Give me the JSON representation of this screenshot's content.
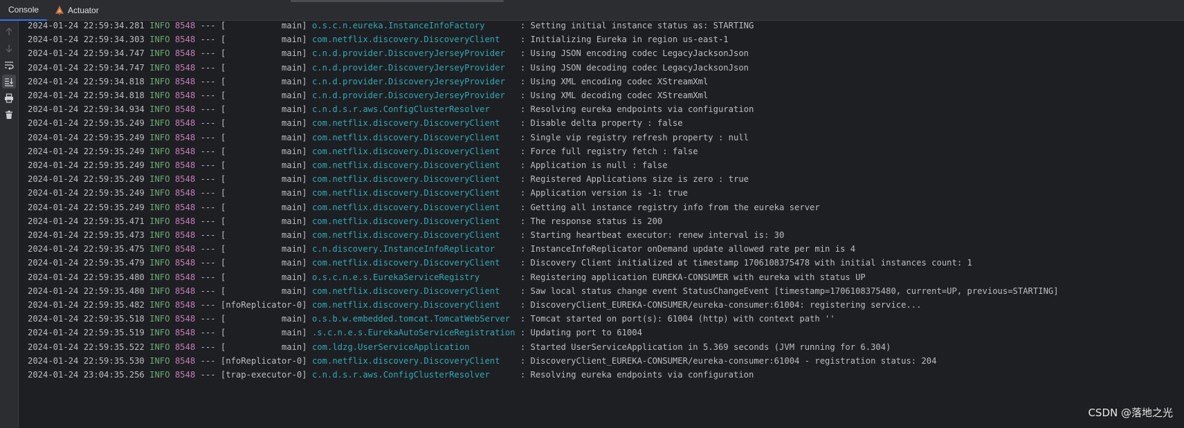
{
  "tabs": [
    {
      "label": "Console",
      "active": true,
      "icon": null
    },
    {
      "label": "Actuator",
      "active": false,
      "icon": "actuator-icon"
    }
  ],
  "gutter": {
    "buttons": [
      {
        "icon": "up-arrow-icon",
        "active": false
      },
      {
        "icon": "down-arrow-icon",
        "active": false
      },
      {
        "icon": "soft-wrap-icon",
        "active": false
      },
      {
        "icon": "scroll-to-end-icon",
        "active": true
      },
      {
        "icon": "print-icon",
        "active": false
      },
      {
        "icon": "trash-icon",
        "active": false
      }
    ]
  },
  "colors": {
    "background": "#1e1f22",
    "panel": "#2b2d30",
    "level": "#6aab73",
    "pid": "#c77dbb",
    "logger": "#2aacb8",
    "text": "#bcbec4",
    "active_tab": "#3574f0"
  },
  "log": [
    {
      "ts": "2024-01-24 22:59:34.281",
      "level": "INFO",
      "pid": "8548",
      "sep": "---",
      "thread": "[           main]",
      "logger": "o.s.c.n.eureka.InstanceInfoFactory      ",
      "msg": ": Setting initial instance status as: STARTING"
    },
    {
      "ts": "2024-01-24 22:59:34.303",
      "level": "INFO",
      "pid": "8548",
      "sep": "---",
      "thread": "[           main]",
      "logger": "com.netflix.discovery.DiscoveryClient   ",
      "msg": ": Initializing Eureka in region us-east-1"
    },
    {
      "ts": "2024-01-24 22:59:34.747",
      "level": "INFO",
      "pid": "8548",
      "sep": "---",
      "thread": "[           main]",
      "logger": "c.n.d.provider.DiscoveryJerseyProvider  ",
      "msg": ": Using JSON encoding codec LegacyJacksonJson"
    },
    {
      "ts": "2024-01-24 22:59:34.747",
      "level": "INFO",
      "pid": "8548",
      "sep": "---",
      "thread": "[           main]",
      "logger": "c.n.d.provider.DiscoveryJerseyProvider  ",
      "msg": ": Using JSON decoding codec LegacyJacksonJson"
    },
    {
      "ts": "2024-01-24 22:59:34.818",
      "level": "INFO",
      "pid": "8548",
      "sep": "---",
      "thread": "[           main]",
      "logger": "c.n.d.provider.DiscoveryJerseyProvider  ",
      "msg": ": Using XML encoding codec XStreamXml"
    },
    {
      "ts": "2024-01-24 22:59:34.818",
      "level": "INFO",
      "pid": "8548",
      "sep": "---",
      "thread": "[           main]",
      "logger": "c.n.d.provider.DiscoveryJerseyProvider  ",
      "msg": ": Using XML decoding codec XStreamXml"
    },
    {
      "ts": "2024-01-24 22:59:34.934",
      "level": "INFO",
      "pid": "8548",
      "sep": "---",
      "thread": "[           main]",
      "logger": "c.n.d.s.r.aws.ConfigClusterResolver     ",
      "msg": ": Resolving eureka endpoints via configuration"
    },
    {
      "ts": "2024-01-24 22:59:35.249",
      "level": "INFO",
      "pid": "8548",
      "sep": "---",
      "thread": "[           main]",
      "logger": "com.netflix.discovery.DiscoveryClient   ",
      "msg": ": Disable delta property : false"
    },
    {
      "ts": "2024-01-24 22:59:35.249",
      "level": "INFO",
      "pid": "8548",
      "sep": "---",
      "thread": "[           main]",
      "logger": "com.netflix.discovery.DiscoveryClient   ",
      "msg": ": Single vip registry refresh property : null"
    },
    {
      "ts": "2024-01-24 22:59:35.249",
      "level": "INFO",
      "pid": "8548",
      "sep": "---",
      "thread": "[           main]",
      "logger": "com.netflix.discovery.DiscoveryClient   ",
      "msg": ": Force full registry fetch : false"
    },
    {
      "ts": "2024-01-24 22:59:35.249",
      "level": "INFO",
      "pid": "8548",
      "sep": "---",
      "thread": "[           main]",
      "logger": "com.netflix.discovery.DiscoveryClient   ",
      "msg": ": Application is null : false"
    },
    {
      "ts": "2024-01-24 22:59:35.249",
      "level": "INFO",
      "pid": "8548",
      "sep": "---",
      "thread": "[           main]",
      "logger": "com.netflix.discovery.DiscoveryClient   ",
      "msg": ": Registered Applications size is zero : true"
    },
    {
      "ts": "2024-01-24 22:59:35.249",
      "level": "INFO",
      "pid": "8548",
      "sep": "---",
      "thread": "[           main]",
      "logger": "com.netflix.discovery.DiscoveryClient   ",
      "msg": ": Application version is -1: true"
    },
    {
      "ts": "2024-01-24 22:59:35.249",
      "level": "INFO",
      "pid": "8548",
      "sep": "---",
      "thread": "[           main]",
      "logger": "com.netflix.discovery.DiscoveryClient   ",
      "msg": ": Getting all instance registry info from the eureka server"
    },
    {
      "ts": "2024-01-24 22:59:35.471",
      "level": "INFO",
      "pid": "8548",
      "sep": "---",
      "thread": "[           main]",
      "logger": "com.netflix.discovery.DiscoveryClient   ",
      "msg": ": The response status is 200"
    },
    {
      "ts": "2024-01-24 22:59:35.473",
      "level": "INFO",
      "pid": "8548",
      "sep": "---",
      "thread": "[           main]",
      "logger": "com.netflix.discovery.DiscoveryClient   ",
      "msg": ": Starting heartbeat executor: renew interval is: 30"
    },
    {
      "ts": "2024-01-24 22:59:35.475",
      "level": "INFO",
      "pid": "8548",
      "sep": "---",
      "thread": "[           main]",
      "logger": "c.n.discovery.InstanceInfoReplicator    ",
      "msg": ": InstanceInfoReplicator onDemand update allowed rate per min is 4"
    },
    {
      "ts": "2024-01-24 22:59:35.479",
      "level": "INFO",
      "pid": "8548",
      "sep": "---",
      "thread": "[           main]",
      "logger": "com.netflix.discovery.DiscoveryClient   ",
      "msg": ": Discovery Client initialized at timestamp 1706108375478 with initial instances count: 1"
    },
    {
      "ts": "2024-01-24 22:59:35.480",
      "level": "INFO",
      "pid": "8548",
      "sep": "---",
      "thread": "[           main]",
      "logger": "o.s.c.n.e.s.EurekaServiceRegistry       ",
      "msg": ": Registering application EUREKA-CONSUMER with eureka with status UP"
    },
    {
      "ts": "2024-01-24 22:59:35.480",
      "level": "INFO",
      "pid": "8548",
      "sep": "---",
      "thread": "[           main]",
      "logger": "com.netflix.discovery.DiscoveryClient   ",
      "msg": ": Saw local status change event StatusChangeEvent [timestamp=1706108375480, current=UP, previous=STARTING]"
    },
    {
      "ts": "2024-01-24 22:59:35.482",
      "level": "INFO",
      "pid": "8548",
      "sep": "---",
      "thread": "[nfoReplicator-0]",
      "logger": "com.netflix.discovery.DiscoveryClient   ",
      "msg": ": DiscoveryClient_EUREKA-CONSUMER/eureka-consumer:61004: registering service..."
    },
    {
      "ts": "2024-01-24 22:59:35.518",
      "level": "INFO",
      "pid": "8548",
      "sep": "---",
      "thread": "[           main]",
      "logger": "o.s.b.w.embedded.tomcat.TomcatWebServer ",
      "msg": ": Tomcat started on port(s): 61004 (http) with context path ''"
    },
    {
      "ts": "2024-01-24 22:59:35.519",
      "level": "INFO",
      "pid": "8548",
      "sep": "---",
      "thread": "[           main]",
      "logger": ".s.c.n.e.s.EurekaAutoServiceRegistration",
      "msg": ": Updating port to 61004"
    },
    {
      "ts": "2024-01-24 22:59:35.522",
      "level": "INFO",
      "pid": "8548",
      "sep": "---",
      "thread": "[           main]",
      "logger": "com.ldzg.UserServiceApplication         ",
      "msg": ": Started UserServiceApplication in 5.369 seconds (JVM running for 6.304)"
    },
    {
      "ts": "2024-01-24 22:59:35.530",
      "level": "INFO",
      "pid": "8548",
      "sep": "---",
      "thread": "[nfoReplicator-0]",
      "logger": "com.netflix.discovery.DiscoveryClient   ",
      "msg": ": DiscoveryClient_EUREKA-CONSUMER/eureka-consumer:61004 - registration status: 204"
    },
    {
      "ts": "2024-01-24 23:04:35.256",
      "level": "INFO",
      "pid": "8548",
      "sep": "---",
      "thread": "[trap-executor-0]",
      "logger": "c.n.d.s.r.aws.ConfigClusterResolver     ",
      "msg": ": Resolving eureka endpoints via configuration"
    }
  ],
  "watermark": "CSDN @落地之光"
}
